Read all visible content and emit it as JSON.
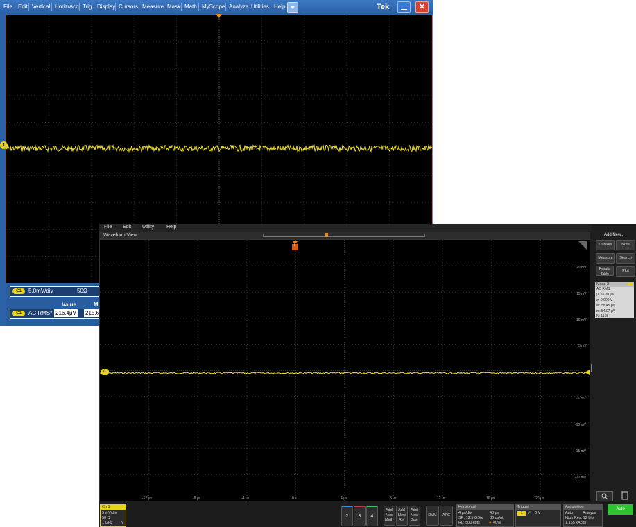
{
  "back_window": {
    "menu": [
      "File",
      "Edit",
      "Vertical",
      "Horiz/Acq",
      "Trig",
      "Display",
      "Cursors",
      "Measure",
      "Mask",
      "Math",
      "MyScope",
      "Analyze",
      "Utilities",
      "Help"
    ],
    "brand": "Tek",
    "ch_marker": "1",
    "channel_badge": "C1",
    "scale": "5.0mV/div",
    "impedance": "50Ω",
    "meas_header_value": "Value",
    "meas_header_next": "M",
    "meas_badge": "C1",
    "meas_name": "AC RMS*",
    "meas_value": "216.4μV",
    "meas_mean": "215.6"
  },
  "front_window": {
    "menu": [
      "File",
      "Edit",
      "Utility",
      "Help"
    ],
    "waveform_title": "Waveform View",
    "trigger_marker": "T",
    "ch_marker": "C",
    "y_ticks": [
      "20 mV",
      "15 mV",
      "10 mV",
      "5 mV",
      "-5 mV",
      "-10 mV",
      "-15 mV",
      "-20 mV"
    ],
    "x_ticks": [
      "-12 μs",
      "-8 μs",
      "-4 μs",
      "0 s",
      "4 μs",
      "8 μs",
      "12 μs",
      "16 μs",
      "20 μs"
    ],
    "side_panel": {
      "title": "Add New...",
      "buttons": [
        "Cursors",
        "Note",
        "Measure",
        "Search",
        "Results Table",
        "Plot"
      ]
    },
    "meas_card": {
      "title": "Meas 2",
      "name": "AC RMS",
      "mu": "μ: 55.70 μV",
      "sigma": "σ: 0.000 V",
      "max": "M: 58.45 μV",
      "min": "m: 54.07 μV",
      "n": "N: 1165"
    },
    "ch1": {
      "label": "Ch 1",
      "scale": "5 mV/div",
      "imp": "50 Ω",
      "bw": "1 GHz"
    },
    "channel_buttons": [
      "2",
      "3",
      "4"
    ],
    "add_buttons": [
      [
        "Add",
        "New",
        "Math"
      ],
      [
        "Add",
        "New",
        "Ref"
      ],
      [
        "Add",
        "New",
        "Bus"
      ]
    ],
    "dvm": "DVM",
    "afg": "AFG",
    "horizontal": {
      "title": "Horizontal",
      "l1a": "4 μs/div",
      "l1b": "40 μs",
      "l2a": "SR: 12.5 GS/s",
      "l2b": "80 ps/pt",
      "l3a": "RL: 500 kpts",
      "l3b": "40%"
    },
    "trigger": {
      "title": "Trigger",
      "badge": "1",
      "level": "0 V"
    },
    "acquisition": {
      "title": "Acquisition",
      "l1a": "Auto,",
      "l1b": "Analyze",
      "l2": "High Res: 12 bits",
      "l3": "1.165 kAcqs"
    },
    "auto_button": "Auto"
  },
  "colors": {
    "trace": "#f2e427",
    "grid": "#3a3a3a",
    "accent_orange": "#d77a1c",
    "badge_yellow": "#e4d21e",
    "auto_green": "#2fc42f"
  }
}
